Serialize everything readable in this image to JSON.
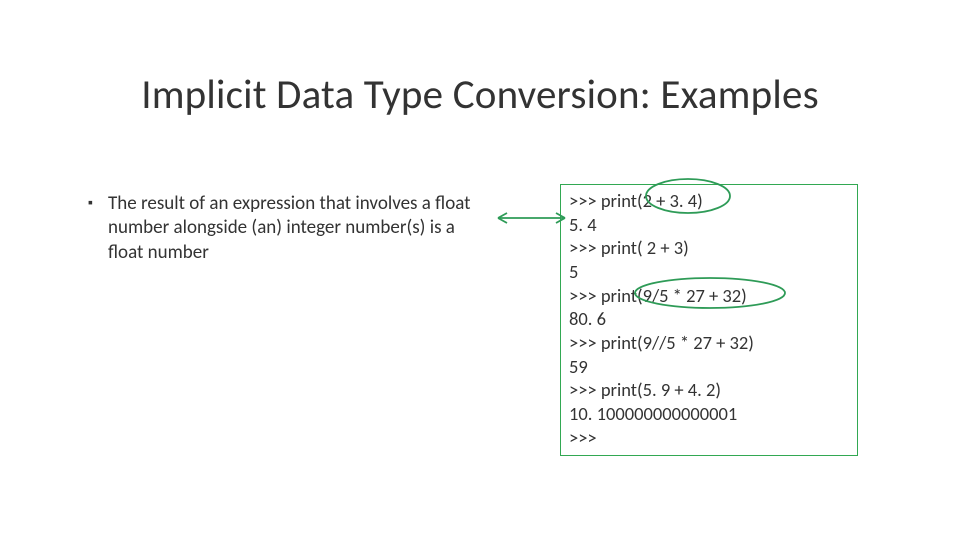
{
  "title": "Implicit Data Type Conversion: Examples",
  "bullet": {
    "text": "The result of an expression that involves a float number alongside (an) integer number(s) is a float number"
  },
  "code": {
    "lines": [
      ">>> print(2 + 3. 4)",
      "5. 4",
      ">>> print( 2 + 3)",
      "5",
      ">>> print(9/5 * 27 + 32)",
      "80. 6",
      ">>> print(9//5 * 27 + 32)",
      "59",
      ">>> print(5. 9 + 4. 2)",
      "10. 100000000000001",
      ">>>"
    ]
  },
  "colors": {
    "annotation": "#2e9b57",
    "box_border": "#32a852"
  }
}
